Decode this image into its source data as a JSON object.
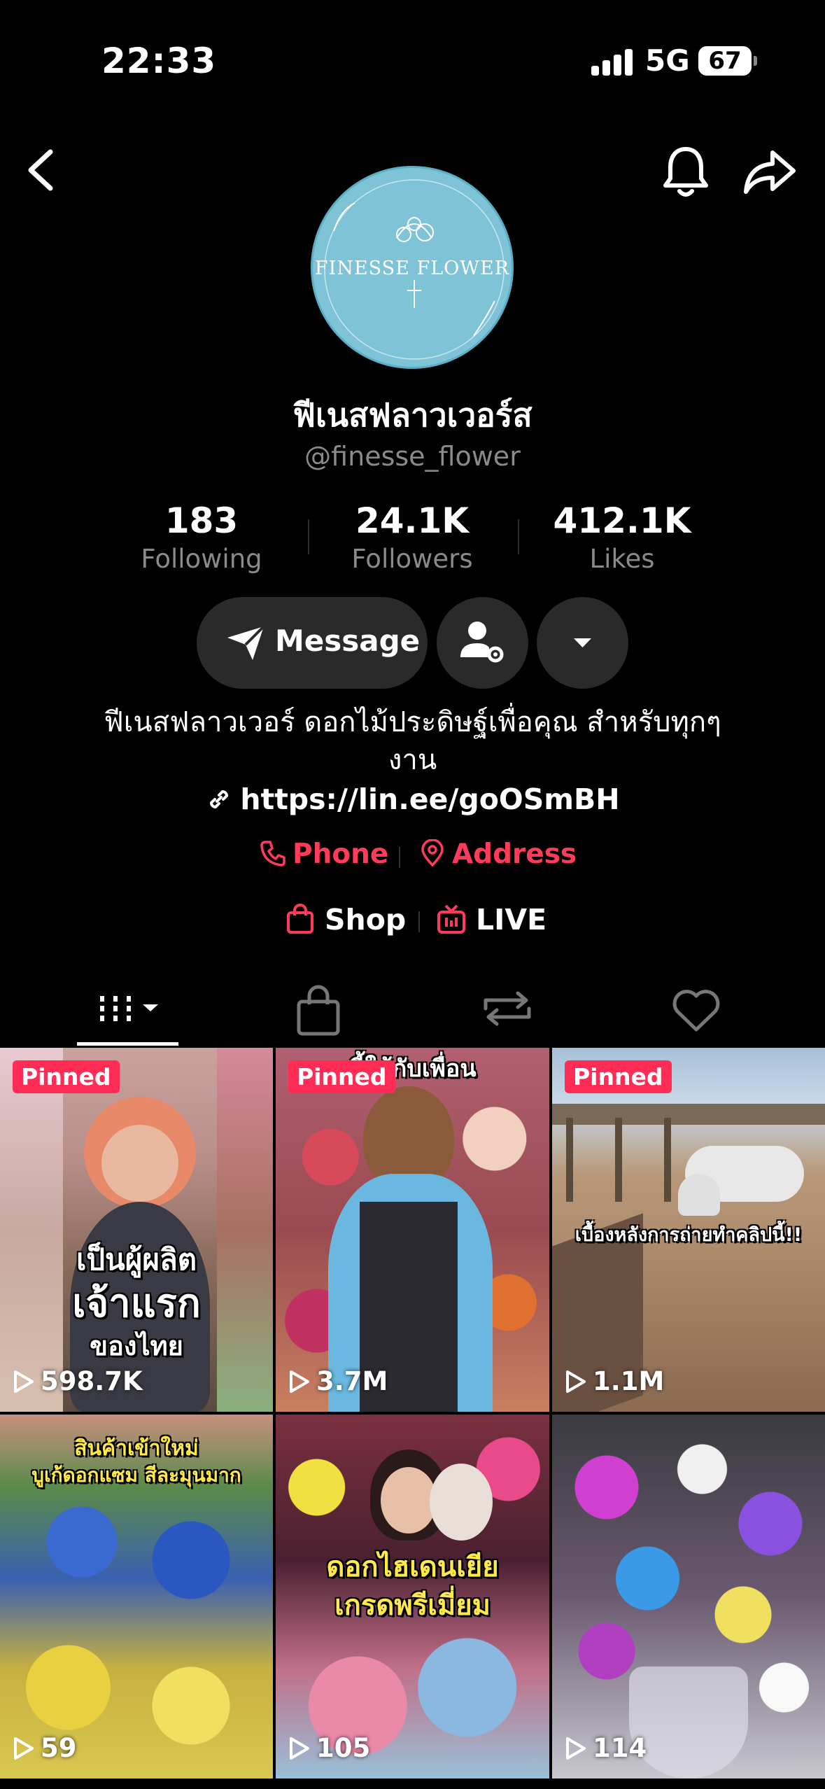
{
  "status_bar": {
    "time": "22:33",
    "network": "5G",
    "battery": "67"
  },
  "profile": {
    "avatar_text": "FINESSE FLOWER",
    "display_name": "ฟีเนสฟลาวเวอร์ส",
    "username": "@finesse_flower",
    "stats": [
      {
        "value": "183",
        "label": "Following"
      },
      {
        "value": "24.1K",
        "label": "Followers"
      },
      {
        "value": "412.1K",
        "label": "Likes"
      }
    ],
    "message_label": "Message",
    "bio": "ฟีเนสฟลาวเวอร์ ดอกไม้ประดิษฐ์เพื่อคุณ สำหรับทุกๆงาน",
    "link": "https://lin.ee/goOSmBH",
    "phone_label": "Phone",
    "address_label": "Address",
    "shop_label": "Shop",
    "live_label": "LIVE"
  },
  "tabs": [
    {
      "name": "videos",
      "icon": "grid-icon"
    },
    {
      "name": "shop",
      "icon": "bag-icon"
    },
    {
      "name": "reposts",
      "icon": "repost-icon"
    },
    {
      "name": "liked",
      "icon": "heart-icon"
    }
  ],
  "videos": [
    {
      "pinned": "Pinned",
      "views": "598.7K",
      "overlay": [
        "เป็นผู้ผลิต",
        "เจ้าแรก",
        "ของไทย"
      ]
    },
    {
      "pinned": "Pinned",
      "views": "3.7M",
      "overlay": [
        "นี้ให้กับเพื่อน"
      ]
    },
    {
      "pinned": "Pinned",
      "views": "1.1M",
      "overlay": [
        "เบื้องหลังการถ่ายทำคลิปนี้!!"
      ]
    },
    {
      "views": "59",
      "overlay": [
        "สินค้าเข้าใหม่",
        "บูเก้ดอกแซม สีละมุนมาก"
      ]
    },
    {
      "views": "105",
      "overlay": [
        "ดอกไฮเดนเยีย",
        "เกรดพรีเมี่ยม"
      ]
    },
    {
      "views": "114"
    }
  ],
  "colors": {
    "accent": "#ff3b5c",
    "pinned": "#ff2d55",
    "avatar_bg": "#7ec3d6"
  }
}
